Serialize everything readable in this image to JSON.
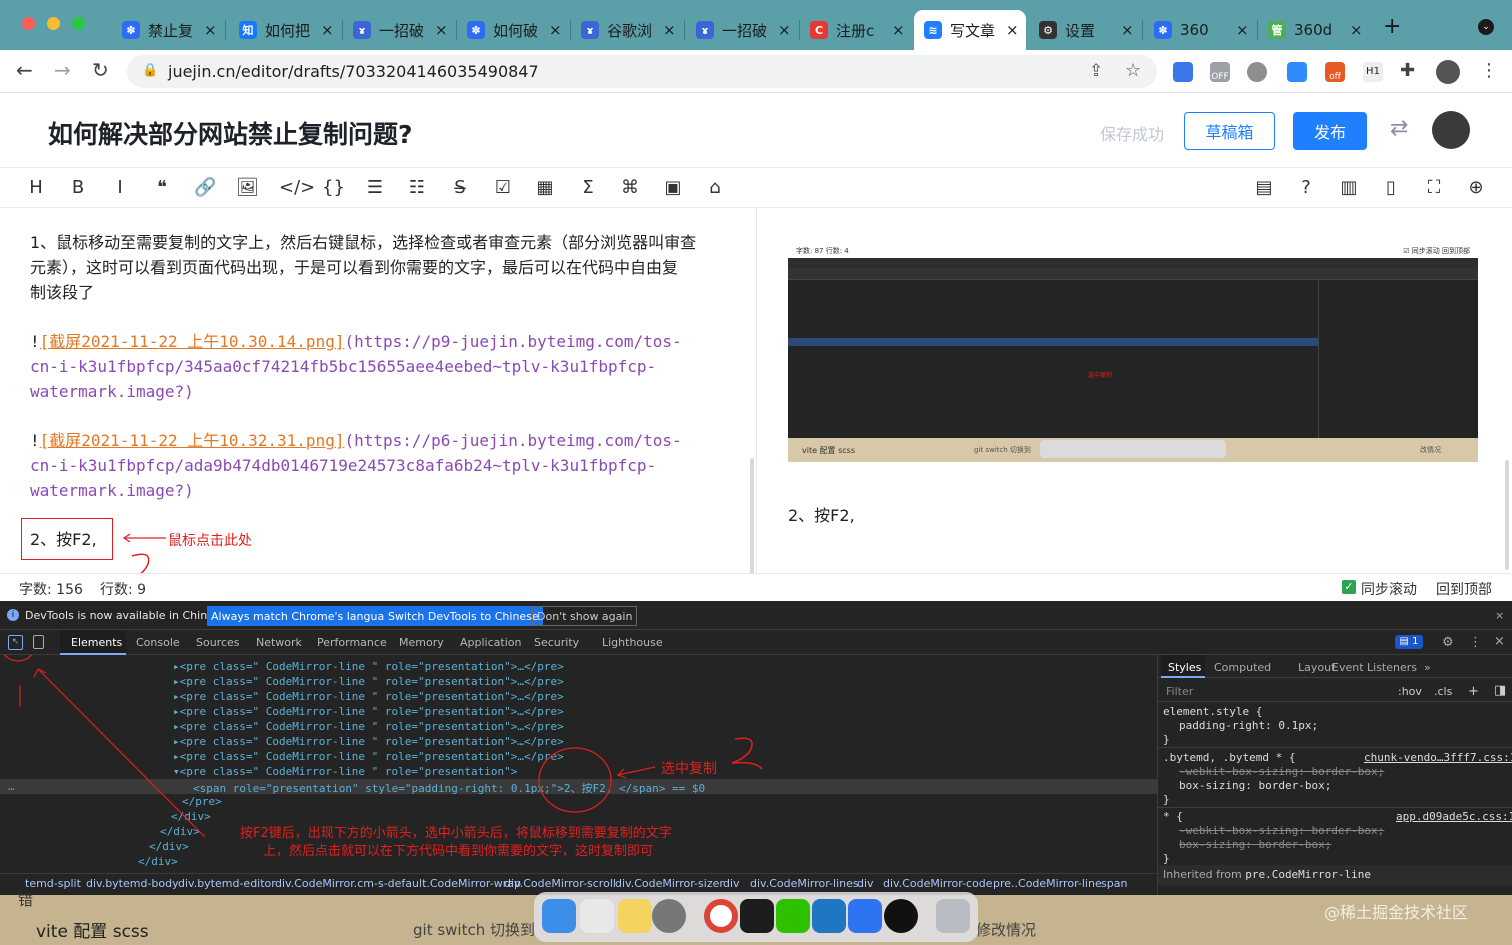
{
  "browser": {
    "tabs": [
      {
        "label": "禁止复",
        "color": "#2d6cf6",
        "glyph": "✽"
      },
      {
        "label": "如何把",
        "color": "#1677ff",
        "glyph": "知"
      },
      {
        "label": "一招破",
        "color": "#3a66d8",
        "glyph": "ɤ"
      },
      {
        "label": "如何破",
        "color": "#2d6cf6",
        "glyph": "✽"
      },
      {
        "label": "谷歌浏",
        "color": "#3a66d8",
        "glyph": "ɤ"
      },
      {
        "label": "一招破",
        "color": "#3a66d8",
        "glyph": "ɤ"
      },
      {
        "label": "注册c",
        "color": "#e53935",
        "glyph": "C"
      },
      {
        "label": "写文章",
        "color": "#1e80ff",
        "glyph": "≋"
      },
      {
        "label": "设置",
        "color": "#333333",
        "glyph": "⚙"
      },
      {
        "label": "360",
        "color": "#2d6cf6",
        "glyph": "✽"
      },
      {
        "label": "360d",
        "color": "#4caf50",
        "glyph": "管"
      }
    ],
    "url": "juejin.cn/editor/drafts/7033204146035490847",
    "ext_off_a": "OFF",
    "ext_off_b": "off",
    "ext_h1": "H1"
  },
  "editor_header": {
    "title": "如何解决部分网站禁止复制问题?",
    "save_status": "保存成功",
    "draft_label": "草稿箱",
    "publish_label": "发布"
  },
  "toolbar": [
    "H",
    "B",
    "I",
    "❝",
    "🔗",
    "🖼",
    "</>",
    "{}",
    "☰",
    "☷",
    "S̶",
    "☑",
    "▦",
    "Σ",
    "⌘",
    "▣",
    "⌂"
  ],
  "toolbar_right": [
    "▤",
    "?",
    "▥",
    "▯",
    "⛶",
    "⊕"
  ],
  "editor": {
    "p1_l1": "1、鼠标移动至需要复制的文字上，然后右键鼠标，选择检查或者审查元素（部分浏览器叫审查",
    "p1_l2": "元素），这时可以看到页面代码出现，于是可以看到你需要的文字，最后可以在代码中自由复",
    "p1_l3": "制该段了",
    "img1_bang": "!",
    "img1_alt": "[截屏2021-11-22 上午10.30.14.png]",
    "img1_l1": "(https://p9-juejin.byteimg.com/tos-",
    "img1_l2": "cn-i-k3u1fbpfcp/345aa0cf74214fb5bc15655aee4eebed~tplv-k3u1fbpfcp-",
    "img1_l3": "watermark.image?)",
    "img2_bang": "!",
    "img2_alt": "[截屏2021-11-22 上午10.32.31.png]",
    "img2_l1": "(https://p6-juejin.byteimg.com/tos-",
    "img2_l2": "cn-i-k3u1fbpfcp/ada9b474db0146719e24573c8afa6b24~tplv-k3u1fbpfcp-",
    "img2_l3": "watermark.image?)",
    "step2": "2、按F2,",
    "annotation": "鼠标点击此处"
  },
  "preview": {
    "img_top_left": "字数: 87    行数: 4",
    "img_top_right": "☑ 同步滚动    回到顶部",
    "img_bottom_a": "vite 配置 scss",
    "img_bottom_b": "git switch 切换到",
    "img_bottom_c": "改情况",
    "step2": "2、按F2,"
  },
  "status": {
    "word_count": "字数: 156",
    "line_count": "行数: 9",
    "sync_scroll": "同步滚动",
    "back_top": "回到顶部"
  },
  "devtools": {
    "banner": "DevTools is now available in Chinese!",
    "btn_match": "Always match Chrome's language",
    "btn_switch": "Switch DevTools to Chinese",
    "btn_dont": "Don't show again",
    "tabs": [
      "Elements",
      "Console",
      "Sources",
      "Network",
      "Performance",
      "Memory",
      "Application",
      "Security",
      "Lighthouse"
    ],
    "issues": "1",
    "pre_line": "▸<pre class=\" CodeMirror-line \" role=\"presentation\">…</pre>",
    "pre_open": "▾<pre class=\" CodeMirror-line \" role=\"presentation\">",
    "span_line": "<span role=\"presentation\" style=\"padding-right: 0.1px;\">2、按F2, </span> == $0",
    "close_pre": "</pre>",
    "close_div": "</div>",
    "ann_copy": "选中复制",
    "ann_l1": "按F2键后，出现下方的小箭头，选中小箭头后，将鼠标移到需要复制的文字",
    "ann_l2": "上，然后点击就可以在下方代码中看到你需要的文字，这时复制即可",
    "crumbs": [
      "temd-split",
      "div.bytemd-body",
      "div.bytemd-editor",
      "div.CodeMirror.cm-s-default.CodeMirror-wrap",
      "div.CodeMirror-scroll",
      "div.CodeMirror-sizer",
      "div",
      "div.CodeMirror-lines",
      "div",
      "div.CodeMirror-code",
      "pre..CodeMirror-line",
      "span"
    ],
    "styles_tabs": [
      "Styles",
      "Computed",
      "Layout",
      "Event Listeners",
      "»"
    ],
    "filter": "Filter",
    "hov": ":hov",
    "cls": ".cls",
    "rules": {
      "r1_sel": "element.style {",
      "r1_prop": "padding-right: 0.1px;",
      "r2_sel": ".bytemd, .bytemd * {",
      "r2_src": "chunk-vendo…3fff7.css:1",
      "r2_p1": "-webkit-box-sizing: border-box;",
      "r2_p2": "box-sizing: border-box;",
      "r3_sel": "* {",
      "r3_src": "app.d09ade5c.css:1",
      "r3_p1": "-webkit-box-sizing: border-box;",
      "r3_p2": "box-sizing: border-box;",
      "close": "}",
      "inherited": "Inherited from",
      "inherited_sel": "pre.CodeMirror-line"
    }
  },
  "dock": {
    "left_text": "vite 配置 scss",
    "mid_text": "git switch 切换到",
    "right_text": "修改情况",
    "watermark": "@稀土掘金技术社区",
    "err": "错"
  },
  "colors": {
    "accent": "#1e80ff",
    "tabstrip": "#5b9fa9",
    "annotation": "#e02020"
  }
}
